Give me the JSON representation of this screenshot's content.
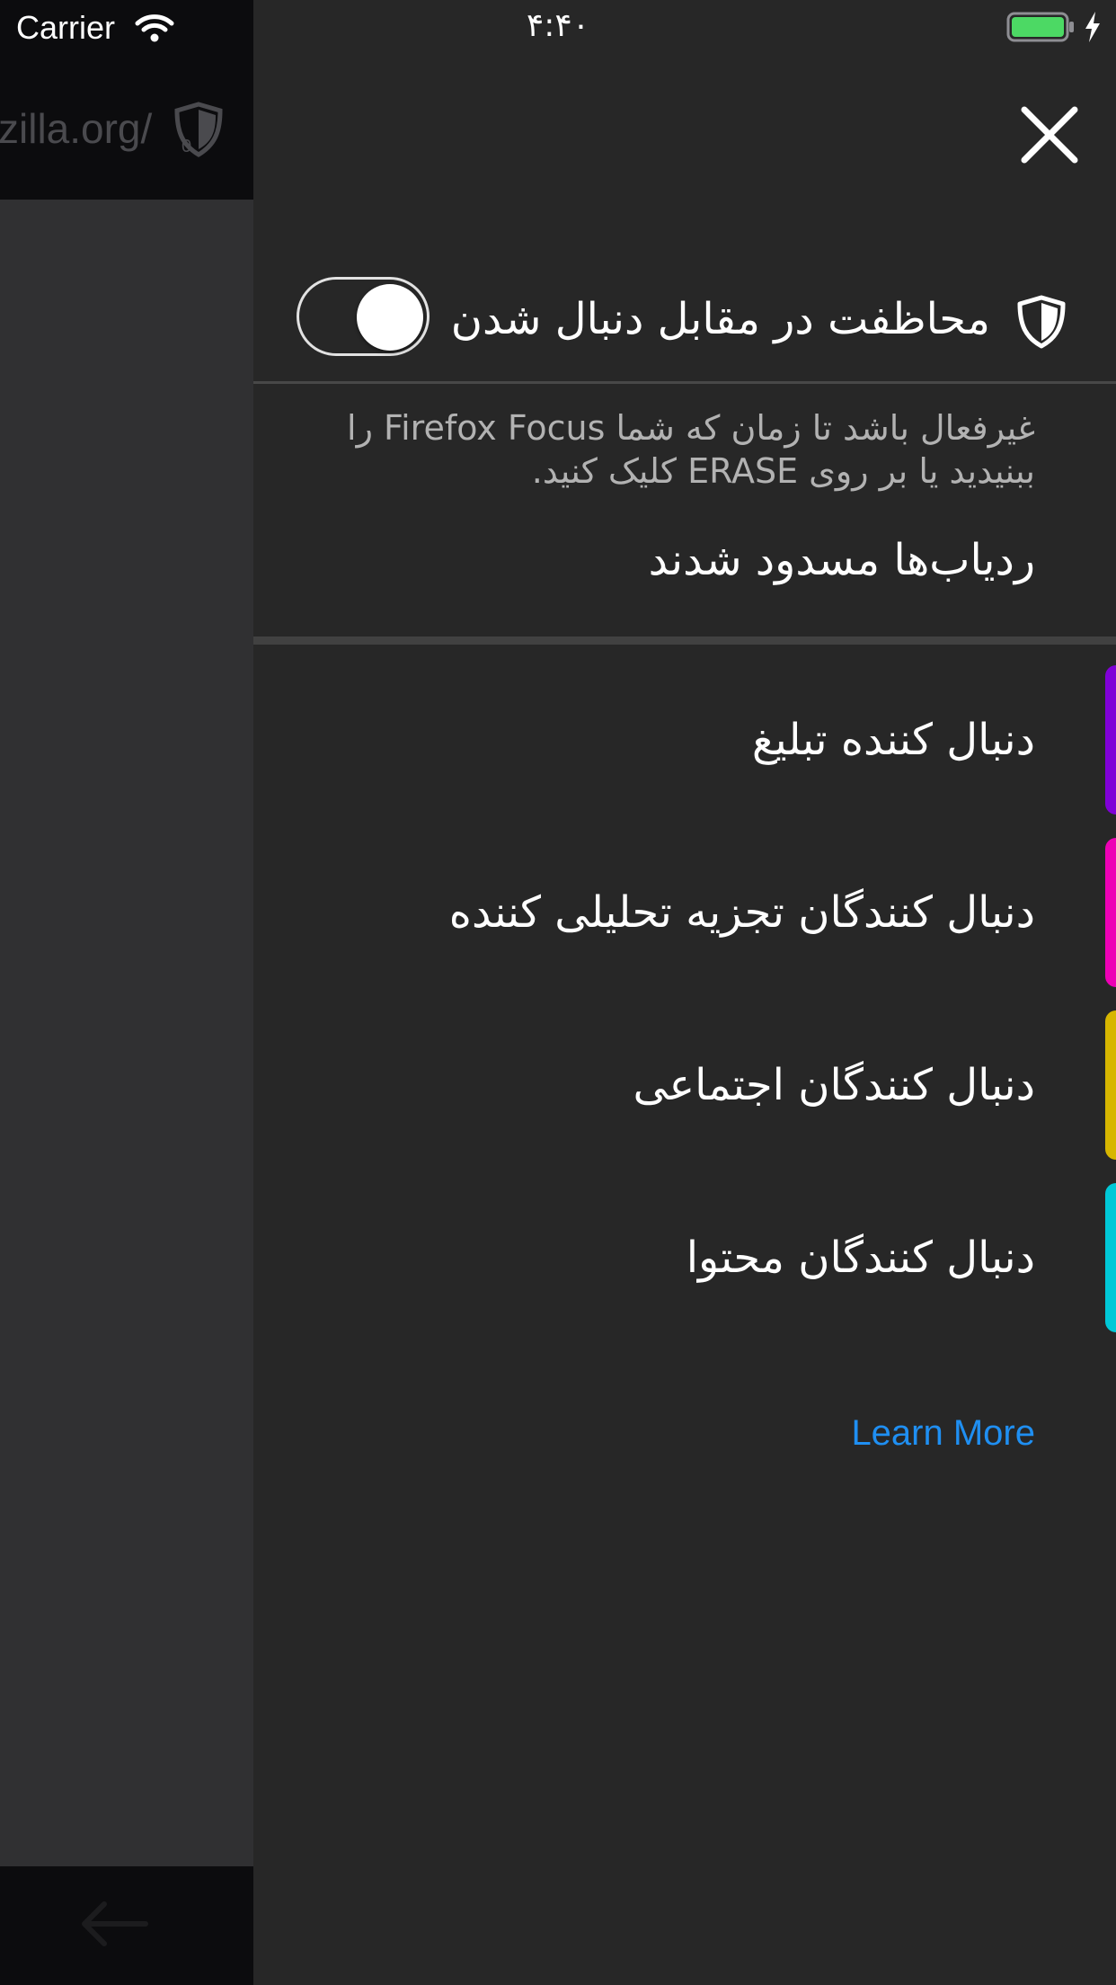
{
  "status_bar": {
    "carrier": "Carrier",
    "time": "۴:۴۰",
    "battery_color": "#4cd964"
  },
  "browser": {
    "url_partial": "zilla.org/",
    "blocked_count_badge": "0",
    "icons": [
      "shield-icon",
      "back-arrow-icon"
    ]
  },
  "panel": {
    "close_icon": "close-icon",
    "toggle": {
      "label": "محاظفت در مقابل دنبال شدن",
      "icon": "shield-icon",
      "state": "on"
    },
    "description": "غیرفعال باشد تا زمان که شما Firefox Focus را ببنیدید یا بر روی ERASE کلیک کنید.",
    "blocked_heading": "ردیاب‌ها مسدود شدند",
    "trackers": [
      {
        "label": "دنبال کننده تبلیغ",
        "color": "#8000d7"
      },
      {
        "label": "دنبال کنندگان تجزیه تحلیلی کننده",
        "color": "#ed00b5"
      },
      {
        "label": "دنبال کنندگان اجتماعی",
        "color": "#d7b600"
      },
      {
        "label": "دنبال کنندگان محتوا",
        "color": "#00c8d7"
      }
    ],
    "learn_more": "Learn More",
    "link_color": "#1f8ff2"
  }
}
